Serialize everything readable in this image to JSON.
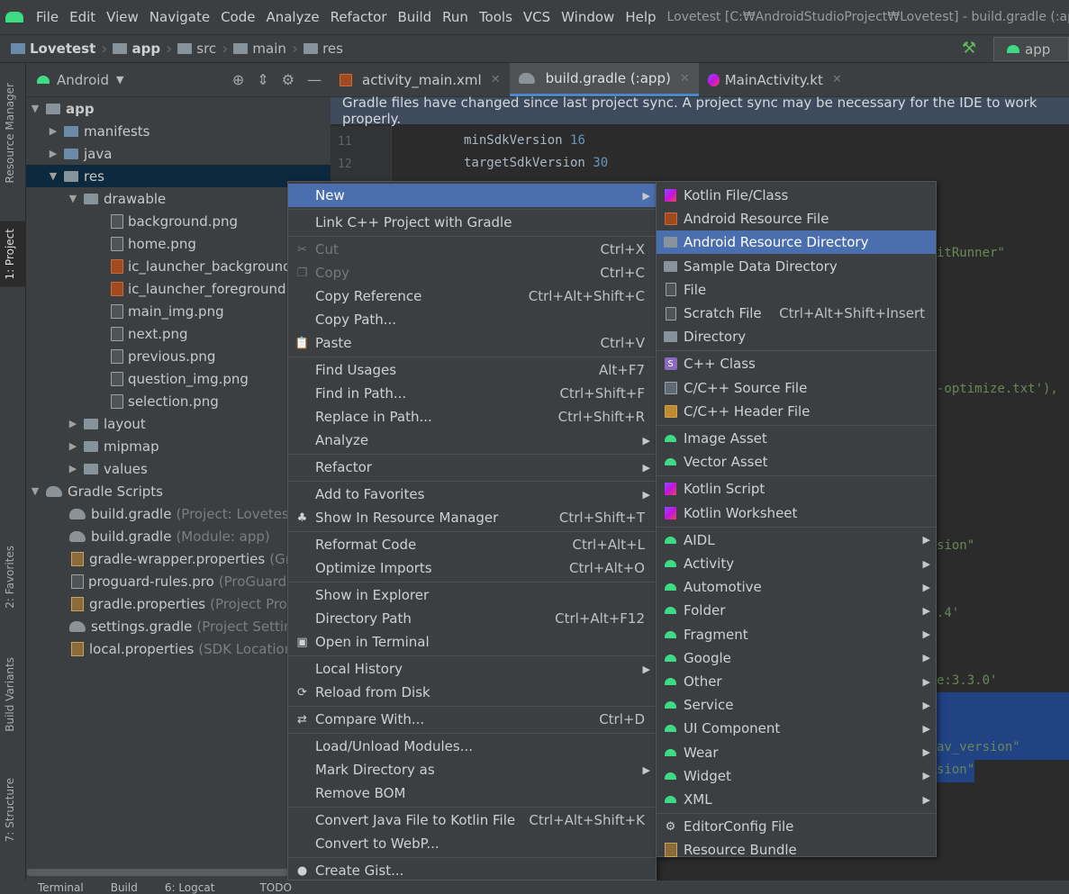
{
  "window": {
    "title": "Lovetest [C:₩AndroidStudioProject₩Lovetest] - build.gradle (:ap",
    "menu": [
      "File",
      "Edit",
      "View",
      "Navigate",
      "Code",
      "Analyze",
      "Refactor",
      "Build",
      "Run",
      "Tools",
      "VCS",
      "Window",
      "Help"
    ]
  },
  "breadcrumb": [
    "Lovetest",
    "app",
    "src",
    "main",
    "res"
  ],
  "run_config": "app",
  "left_tabs": [
    "Resource Manager",
    "1: Project",
    "2: Favorites",
    "Build Variants",
    "7: Structure"
  ],
  "project": {
    "view_mode": "Android",
    "tree": [
      {
        "label": "app",
        "hint": ""
      },
      {
        "label": "manifests",
        "hint": ""
      },
      {
        "label": "java",
        "hint": ""
      },
      {
        "label": "res",
        "hint": ""
      },
      {
        "label": "drawable",
        "hint": ""
      },
      {
        "label": "background.png",
        "hint": ""
      },
      {
        "label": "home.png",
        "hint": ""
      },
      {
        "label": "ic_launcher_background.x",
        "hint": ""
      },
      {
        "label": "ic_launcher_foreground.xr",
        "hint": ""
      },
      {
        "label": "main_img.png",
        "hint": ""
      },
      {
        "label": "next.png",
        "hint": ""
      },
      {
        "label": "previous.png",
        "hint": ""
      },
      {
        "label": "question_img.png",
        "hint": ""
      },
      {
        "label": "selection.png",
        "hint": ""
      },
      {
        "label": "layout",
        "hint": ""
      },
      {
        "label": "mipmap",
        "hint": ""
      },
      {
        "label": "values",
        "hint": ""
      },
      {
        "label": "Gradle Scripts",
        "hint": ""
      },
      {
        "label": "build.gradle",
        "hint": "(Project: Lovetest)"
      },
      {
        "label": "build.gradle",
        "hint": "(Module: app)"
      },
      {
        "label": "gradle-wrapper.properties",
        "hint": "(Grad"
      },
      {
        "label": "proguard-rules.pro",
        "hint": "(ProGuard R"
      },
      {
        "label": "gradle.properties",
        "hint": "(Project Proper"
      },
      {
        "label": "settings.gradle",
        "hint": "(Project Settings)"
      },
      {
        "label": "local.properties",
        "hint": "(SDK Location)"
      }
    ]
  },
  "editor": {
    "tabs": [
      "activity_main.xml",
      "build.gradle (:app)",
      "MainActivity.kt"
    ],
    "notice": "Gradle files have changed since last project sync. A project sync may be necessary for the IDE to work properly.",
    "line_numbers": [
      "11",
      "12"
    ],
    "code": {
      "l11_key": "minSdkVersion ",
      "l11_val": "16",
      "l12_key": "targetSdkVersion ",
      "l12_val": "30",
      "frag_runner": "itRunner\"",
      "frag_optimize": "-optimize.txt'),",
      "frag_sion1": "sion\"",
      "frag_4": ".4'",
      "frag_330": "e:3.3.0'",
      "frag_nav": "av_version\"",
      "frag_sion2": "sion\""
    }
  },
  "context_menu": [
    {
      "label": "New",
      "shortcut": "",
      "sub": true,
      "icon": "",
      "dis": false
    },
    {
      "label": "Link C++ Project with Gradle",
      "shortcut": "",
      "sub": false,
      "icon": "",
      "dis": false
    },
    {
      "label": "Cut",
      "shortcut": "Ctrl+X",
      "sub": false,
      "icon": "scissors-icon",
      "dis": true
    },
    {
      "label": "Copy",
      "shortcut": "Ctrl+C",
      "sub": false,
      "icon": "copy-icon",
      "dis": true
    },
    {
      "label": "Copy Reference",
      "shortcut": "Ctrl+Alt+Shift+C",
      "sub": false,
      "icon": "",
      "dis": false
    },
    {
      "label": "Copy Path...",
      "shortcut": "",
      "sub": false,
      "icon": "",
      "dis": false
    },
    {
      "label": "Paste",
      "shortcut": "Ctrl+V",
      "sub": false,
      "icon": "clipboard-icon",
      "dis": false
    },
    {
      "label": "Find Usages",
      "shortcut": "Alt+F7",
      "sub": false,
      "icon": "",
      "dis": false
    },
    {
      "label": "Find in Path...",
      "shortcut": "Ctrl+Shift+F",
      "sub": false,
      "icon": "",
      "dis": false
    },
    {
      "label": "Replace in Path...",
      "shortcut": "Ctrl+Shift+R",
      "sub": false,
      "icon": "",
      "dis": false
    },
    {
      "label": "Analyze",
      "shortcut": "",
      "sub": true,
      "icon": "",
      "dis": false
    },
    {
      "label": "Refactor",
      "shortcut": "",
      "sub": true,
      "icon": "",
      "dis": false
    },
    {
      "label": "Add to Favorites",
      "shortcut": "",
      "sub": true,
      "icon": "",
      "dis": false
    },
    {
      "label": "Show In Resource Manager",
      "shortcut": "Ctrl+Shift+T",
      "sub": false,
      "icon": "resource-manager-icon",
      "dis": false
    },
    {
      "label": "Reformat Code",
      "shortcut": "Ctrl+Alt+L",
      "sub": false,
      "icon": "",
      "dis": false
    },
    {
      "label": "Optimize Imports",
      "shortcut": "Ctrl+Alt+O",
      "sub": false,
      "icon": "",
      "dis": false
    },
    {
      "label": "Show in Explorer",
      "shortcut": "",
      "sub": false,
      "icon": "",
      "dis": false
    },
    {
      "label": "Directory Path",
      "shortcut": "Ctrl+Alt+F12",
      "sub": false,
      "icon": "",
      "dis": false
    },
    {
      "label": "Open in Terminal",
      "shortcut": "",
      "sub": false,
      "icon": "terminal-icon",
      "dis": false
    },
    {
      "label": "Local History",
      "shortcut": "",
      "sub": true,
      "icon": "",
      "dis": false
    },
    {
      "label": "Reload from Disk",
      "shortcut": "",
      "sub": false,
      "icon": "reload-icon",
      "dis": false
    },
    {
      "label": "Compare With...",
      "shortcut": "Ctrl+D",
      "sub": false,
      "icon": "compare-icon",
      "dis": false
    },
    {
      "label": "Load/Unload Modules...",
      "shortcut": "",
      "sub": false,
      "icon": "",
      "dis": false
    },
    {
      "label": "Mark Directory as",
      "shortcut": "",
      "sub": true,
      "icon": "",
      "dis": false
    },
    {
      "label": "Remove BOM",
      "shortcut": "",
      "sub": false,
      "icon": "",
      "dis": false
    },
    {
      "label": "Convert Java File to Kotlin File",
      "shortcut": "Ctrl+Alt+Shift+K",
      "sub": false,
      "icon": "",
      "dis": false
    },
    {
      "label": "Convert to WebP...",
      "shortcut": "",
      "sub": false,
      "icon": "",
      "dis": false
    },
    {
      "label": "Create Gist...",
      "shortcut": "",
      "sub": false,
      "icon": "github-icon",
      "dis": false
    }
  ],
  "new_submenu": [
    {
      "label": "Kotlin File/Class",
      "shortcut": "",
      "sub": false,
      "icon": "kotlin-file-icon"
    },
    {
      "label": "Android Resource File",
      "shortcut": "",
      "sub": false,
      "icon": "android-resource-file-icon"
    },
    {
      "label": "Android Resource Directory",
      "shortcut": "",
      "sub": false,
      "icon": "folder-icon"
    },
    {
      "label": "Sample Data Directory",
      "shortcut": "",
      "sub": false,
      "icon": "folder-icon"
    },
    {
      "label": "File",
      "shortcut": "",
      "sub": false,
      "icon": "file-icon"
    },
    {
      "label": "Scratch File",
      "shortcut": "Ctrl+Alt+Shift+Insert",
      "sub": false,
      "icon": "scratch-file-icon"
    },
    {
      "label": "Directory",
      "shortcut": "",
      "sub": false,
      "icon": "folder-icon"
    },
    {
      "label": "C++ Class",
      "shortcut": "",
      "sub": false,
      "icon": "cpp-class-icon"
    },
    {
      "label": "C/C++ Source File",
      "shortcut": "",
      "sub": false,
      "icon": "cpp-source-icon"
    },
    {
      "label": "C/C++ Header File",
      "shortcut": "",
      "sub": false,
      "icon": "cpp-header-icon"
    },
    {
      "label": "Image Asset",
      "shortcut": "",
      "sub": false,
      "icon": "android-icon"
    },
    {
      "label": "Vector Asset",
      "shortcut": "",
      "sub": false,
      "icon": "android-icon"
    },
    {
      "label": "Kotlin Script",
      "shortcut": "",
      "sub": false,
      "icon": "kotlin-file-icon"
    },
    {
      "label": "Kotlin Worksheet",
      "shortcut": "",
      "sub": false,
      "icon": "kotlin-file-icon"
    },
    {
      "label": "AIDL",
      "shortcut": "",
      "sub": true,
      "icon": "android-icon"
    },
    {
      "label": "Activity",
      "shortcut": "",
      "sub": true,
      "icon": "android-icon"
    },
    {
      "label": "Automotive",
      "shortcut": "",
      "sub": true,
      "icon": "android-icon"
    },
    {
      "label": "Folder",
      "shortcut": "",
      "sub": true,
      "icon": "android-icon"
    },
    {
      "label": "Fragment",
      "shortcut": "",
      "sub": true,
      "icon": "android-icon"
    },
    {
      "label": "Google",
      "shortcut": "",
      "sub": true,
      "icon": "android-icon"
    },
    {
      "label": "Other",
      "shortcut": "",
      "sub": true,
      "icon": "android-icon"
    },
    {
      "label": "Service",
      "shortcut": "",
      "sub": true,
      "icon": "android-icon"
    },
    {
      "label": "UI Component",
      "shortcut": "",
      "sub": true,
      "icon": "android-icon"
    },
    {
      "label": "Wear",
      "shortcut": "",
      "sub": true,
      "icon": "android-icon"
    },
    {
      "label": "Widget",
      "shortcut": "",
      "sub": true,
      "icon": "android-icon"
    },
    {
      "label": "XML",
      "shortcut": "",
      "sub": true,
      "icon": "android-icon"
    },
    {
      "label": "EditorConfig File",
      "shortcut": "",
      "sub": false,
      "icon": "gear-icon"
    },
    {
      "label": "Resource Bundle",
      "shortcut": "",
      "sub": false,
      "icon": "resource-bundle-icon"
    }
  ],
  "bottom_tabs": [
    "Terminal",
    "Build",
    "6: Logcat",
    "TODO"
  ]
}
